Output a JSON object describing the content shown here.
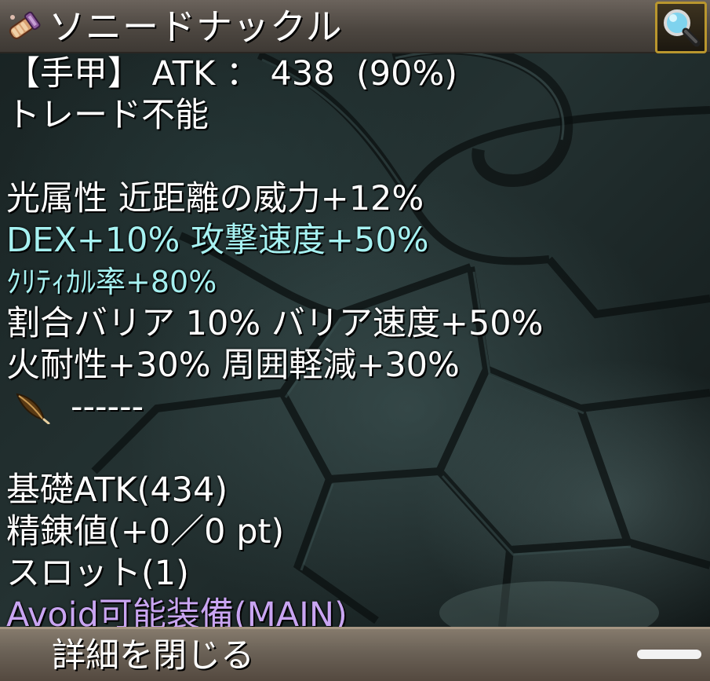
{
  "item": {
    "name": "ソニードナックル",
    "icon": "gauntlet-icon"
  },
  "zoom_button": {
    "icon": "magnifier-icon"
  },
  "stats": {
    "type_line": "【手甲】 ATK ： 438  (90%)",
    "trade": "トレード不能",
    "element_line": "光属性 近距離の威力+12%",
    "dex_line": "DEX+10% 攻撃速度+50%",
    "crit_line": "ｸﾘﾃｨｶﾙ率+80%",
    "barrier_line": "割合バリア 10% バリア速度+50%",
    "resist_line": "火耐性+30% 周囲軽減+30%",
    "separator": "------",
    "separator_icon": "feather-icon",
    "base_atk": "基礎ATK(434)",
    "refine": "精錬値(+0／0 pt)",
    "slot": "スロット(1)",
    "avoid": "Avoid可能装備(MAIN)"
  },
  "close_button": {
    "label": "詳細を閉じる"
  },
  "colors": {
    "text": "#ffffff",
    "highlight": "#a6f1f1",
    "special": "#c9a5f2",
    "frame_gold": "#b9962e"
  }
}
